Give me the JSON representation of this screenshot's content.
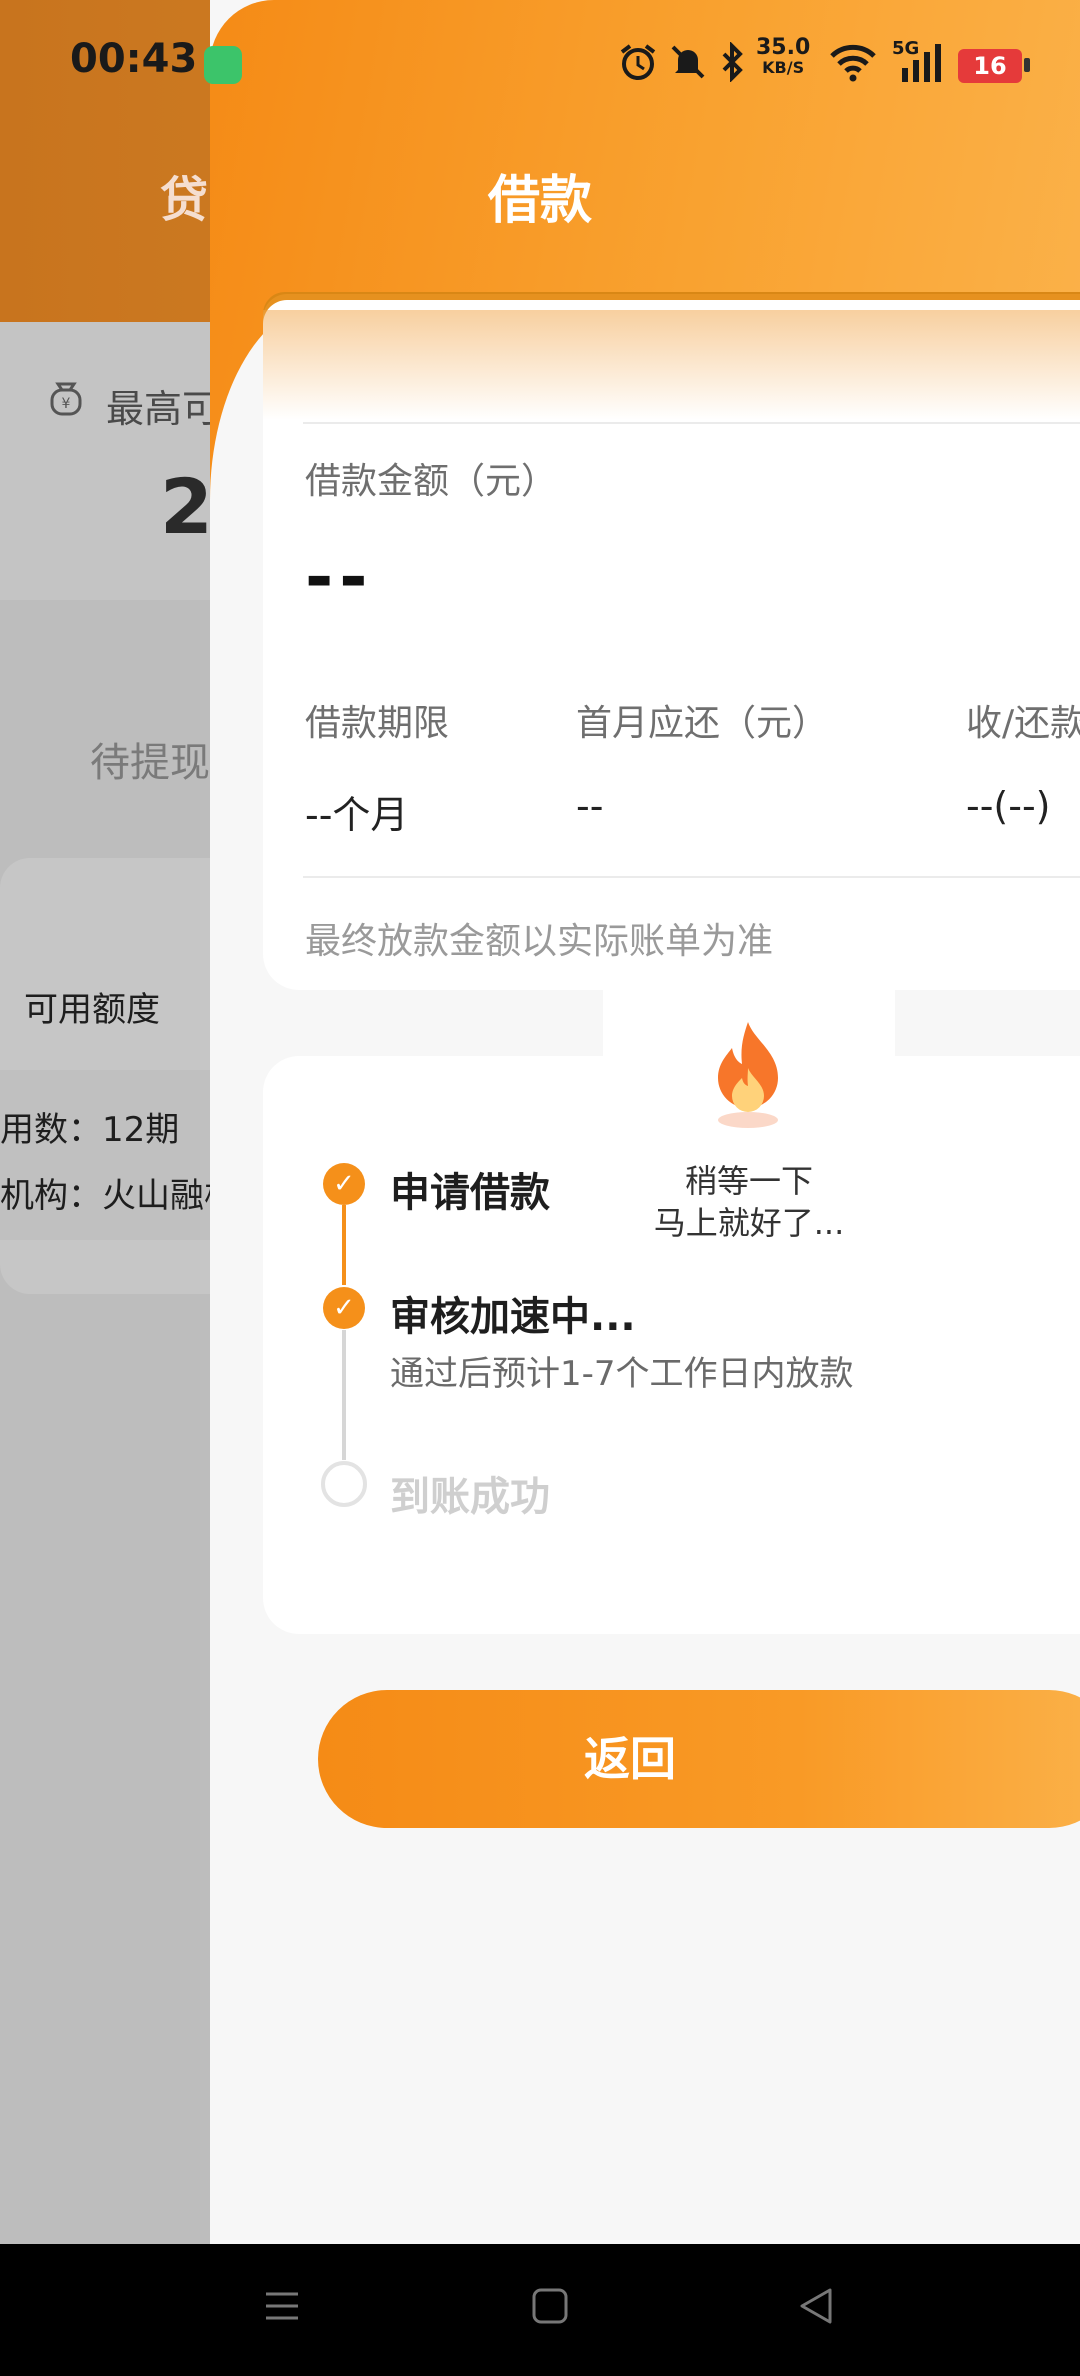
{
  "status_bar": {
    "time": "00:43",
    "net_speed": "35.0",
    "net_unit": "KB/S",
    "network": "5G",
    "battery": "16",
    "icons": [
      "alarm-icon",
      "mute-icon",
      "bluetooth-icon",
      "wifi-icon",
      "signal-icon",
      "battery-icon"
    ]
  },
  "background_page": {
    "header_title_partial": "贷",
    "max_amount_label_partial": "最高可",
    "max_amount_partial": "2",
    "pending_label_partial": "待提现",
    "available_label": "可用额度",
    "periods_partial": "用数：12期",
    "institution_partial": "机构：火山融极"
  },
  "panel": {
    "title": "借款",
    "loan_amount_label": "借款金额（元）",
    "loan_amount_value": "--",
    "term_label": "借款期限",
    "term_value": "--个月",
    "first_month_label": "首月应还（元）",
    "first_month_value": "--",
    "receive_label_partial": "收/还款",
    "receive_value": "--(--)",
    "note": "最终放款金额以实际账单为准"
  },
  "progress": {
    "waiting_line1": "稍等一下",
    "waiting_line2": "马上就好了...",
    "steps": [
      {
        "title": "申请借款",
        "sub": "",
        "done": true
      },
      {
        "title": "审核加速中...",
        "sub": "通过后预计1-7个工作日内放款",
        "done": true
      },
      {
        "title": "到账成功",
        "sub": "",
        "done": false
      }
    ]
  },
  "actions": {
    "back_label": "返回"
  },
  "colors": {
    "accent": "#f5901a",
    "accent_light": "#fbb24a",
    "text_dark": "#1e1e1e",
    "text_muted": "#6f6f6f",
    "inactive": "#e3e3e3"
  }
}
